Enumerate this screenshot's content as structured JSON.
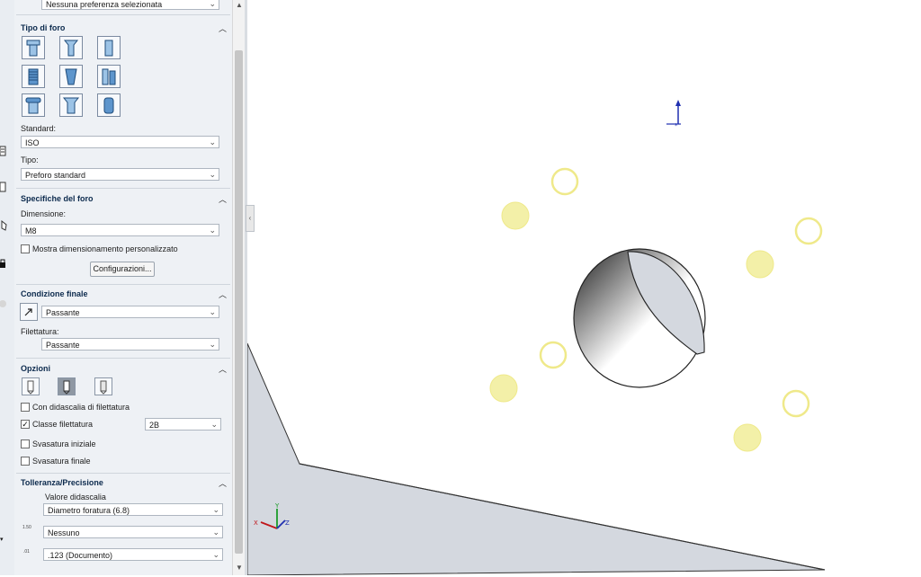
{
  "top_dropdown": {
    "value": "Nessuna preferenza selezionata"
  },
  "tipo_di_foro": {
    "title": "Tipo di foro",
    "hole_types": [
      "counterbore-hole-icon",
      "countersink-hole-icon",
      "straight-hole-icon",
      "tapped-hole-icon",
      "tapered-hole-icon",
      "legacy-hole-icon",
      "counterbore-slot-icon",
      "countersink-slot-icon",
      "straight-slot-icon"
    ],
    "standard_label": "Standard:",
    "standard_value": "ISO",
    "tipo_label": "Tipo:",
    "tipo_value": "Preforo standard"
  },
  "specifiche": {
    "title": "Specifiche del foro",
    "dimensione_label": "Dimensione:",
    "dimensione_value": "M8",
    "custom_label": "Mostra dimensionamento personalizzato",
    "config_button": "Configurazioni..."
  },
  "condizione": {
    "title": "Condizione finale",
    "end_value": "Passante",
    "filettatura_label": "Filettatura:",
    "filettatura_value": "Passante"
  },
  "opzioni": {
    "title": "Opzioni",
    "callout_label": "Con didascalia di filettatura",
    "classe_label": "Classe filettatura",
    "classe_value": "2B",
    "svasatura_iniziale": "Svasatura iniziale",
    "svasatura_finale": "Svasatura finale"
  },
  "tolleranza": {
    "title": "Tolleranza/Precisione",
    "valore_label": "Valore didascalia",
    "valore_value": "Diametro foratura (6.8)",
    "tolerance_icon_text": "1.50",
    "tolerance_value": "Nessuno",
    "precision_icon_text": ".01",
    "precision_value": ".123 (Documento)"
  },
  "colors": {
    "panel_bg": "#eef1f5",
    "section_title": "#0c2a4d",
    "preview_fill": "#f3f0a8",
    "preview_stroke": "#efe98a",
    "model_face": "#d4d8df"
  },
  "axes": {
    "x": "X",
    "y": "Y",
    "z": "Z"
  }
}
